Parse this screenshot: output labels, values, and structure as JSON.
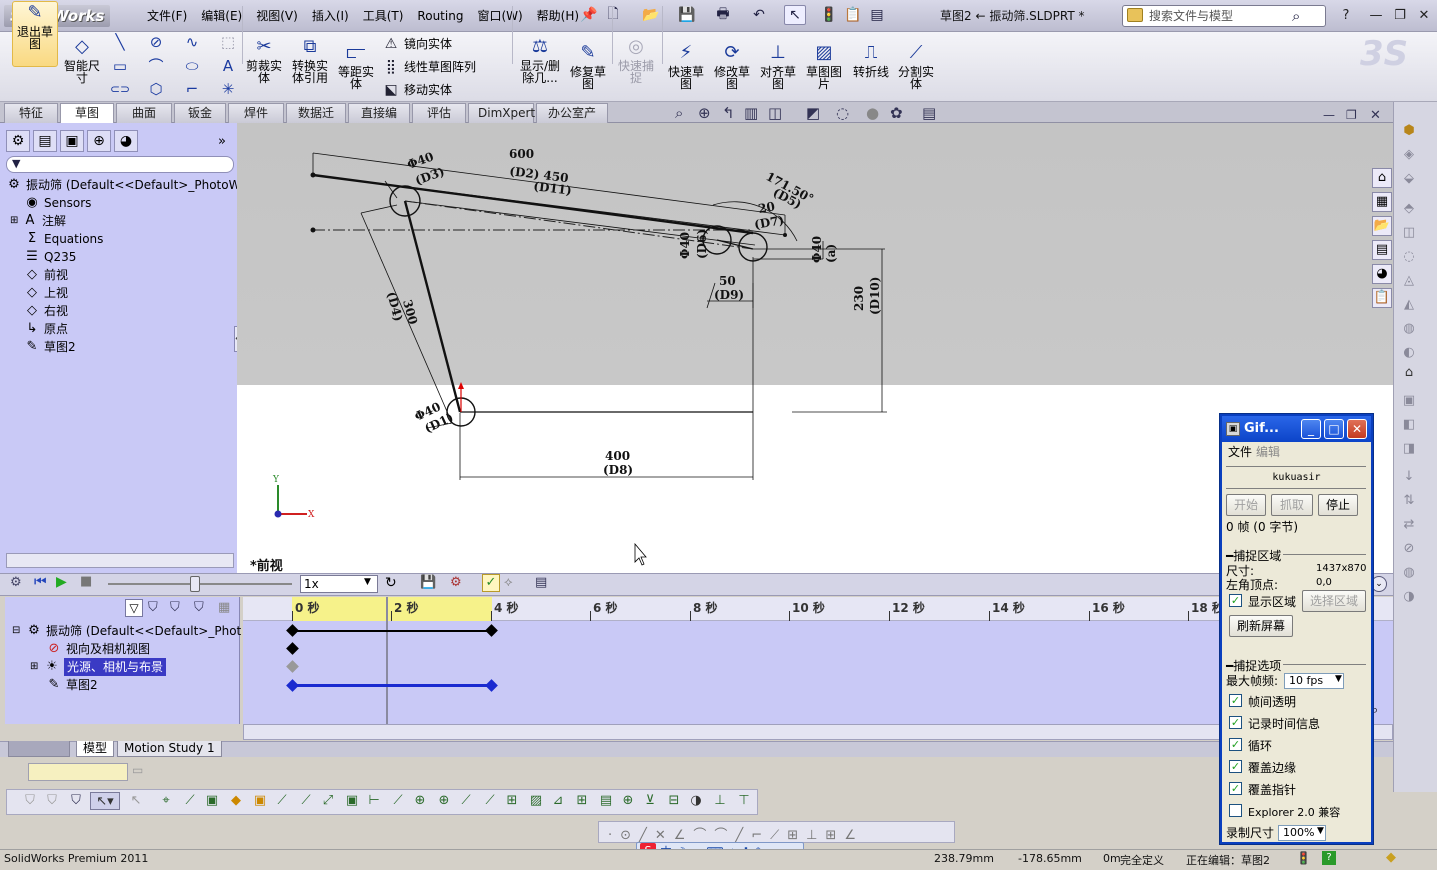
{
  "app": {
    "logo": "SolidWorks",
    "doc_title": "草图2 ← 振动筛.SLDPRT *"
  },
  "menu": [
    "文件(F)",
    "编辑(E)",
    "视图(V)",
    "插入(I)",
    "工具(T)",
    "Routing",
    "窗口(W)",
    "帮助(H)"
  ],
  "search": {
    "placeholder": "搜索文件与模型"
  },
  "ribbon": {
    "exit_sketch": "退出草图",
    "smart_dim": "智能尺寸",
    "trim": "剪裁实体",
    "convert": "转换实体引用",
    "offset": "等距实体",
    "mirror": "镜向实体",
    "linear_pattern": "线性草图阵列",
    "move": "移动实体",
    "show_delete": "显示/删除几...",
    "repair": "修复草图",
    "quick_snap": "快速捕捉",
    "rapid_sketch": "快速草图",
    "modify": "修改草图",
    "align": "对齐草图",
    "picture": "草图图片",
    "jog": "转折线",
    "split": "分割实体"
  },
  "command_tabs": [
    "特征",
    "草图",
    "曲面",
    "钣金",
    "焊件",
    "数据迁移",
    "直接编辑",
    "评估",
    "DimXpert",
    "办公室产品"
  ],
  "active_tab": "草图",
  "feature_tree": {
    "root": "振动筛  (Default<<Default>_PhotoWor",
    "items": [
      "Sensors",
      "注解",
      "Equations",
      "Q235",
      "前视",
      "上视",
      "右视",
      "原点",
      "草图2"
    ]
  },
  "sketch": {
    "dims": {
      "d600": "600",
      "d2_450": "(D2) 450",
      "d11": "(D11)",
      "phi40_d3": "Φ40",
      "d3": "(D3)",
      "ang": "171.50°",
      "d5": "(D5)",
      "d20": "20",
      "d7": "(D7)",
      "phi40_d6": "Φ40",
      "d6": "(D6)",
      "phi40_a": "Φ40",
      "a": "(a)",
      "d50": "50",
      "d9": "(D9)",
      "d230": "230",
      "d10": "(D10)",
      "d300": "300",
      "d4": "(D4)",
      "phi40_d1": "Φ40",
      "d1": "(D1)",
      "d400": "400",
      "d8": "(D8)"
    },
    "axis_y": "Y",
    "axis_x": "X",
    "view_label": "*前视"
  },
  "motion": {
    "speed": "1x",
    "ticks": [
      "0 秒",
      "2 秒",
      "4 秒",
      "6 秒",
      "8 秒",
      "10 秒",
      "12 秒",
      "14 秒",
      "16 秒",
      "18 秒"
    ],
    "tree": [
      "振动筛  (Default<<Default>_Phot",
      "视向及相机视图",
      "光源、相机与布景",
      "草图2"
    ],
    "tabs": [
      "模型",
      "Motion Study 1"
    ]
  },
  "gif": {
    "title": "Gif...",
    "menu_file": "文件",
    "menu_edit": "编辑",
    "user": "kukuasir",
    "btn_start": "开始",
    "btn_grab": "抓取",
    "btn_stop": "停止",
    "frames": "0 帧  (0 字节)",
    "sec_capture": "捕捉区域",
    "size_label": "尺寸:",
    "size_value": "1437x870",
    "origin_label": "左角顶点:",
    "origin_value": "0,0",
    "show_region": "显示区域",
    "select_region": "选择区域",
    "refresh": "刷新屏幕",
    "sec_options": "捕捉选项",
    "max_fps_label": "最大帧频:",
    "max_fps": "10 fps",
    "opt1": "帧间透明",
    "opt2": "记录时间信息",
    "opt3": "循环",
    "opt4": "覆盖边缘",
    "opt5": "覆盖指针",
    "opt6": "Explorer 2.0 兼容",
    "rec_size_label": "录制尺寸",
    "rec_size": "100%"
  },
  "status": {
    "product": "SolidWorks Premium 2011",
    "x": "238.79mm",
    "y": "-178.65mm",
    "z": "0m",
    "defined": "完全定义",
    "editing": "正在编辑：草图2"
  }
}
